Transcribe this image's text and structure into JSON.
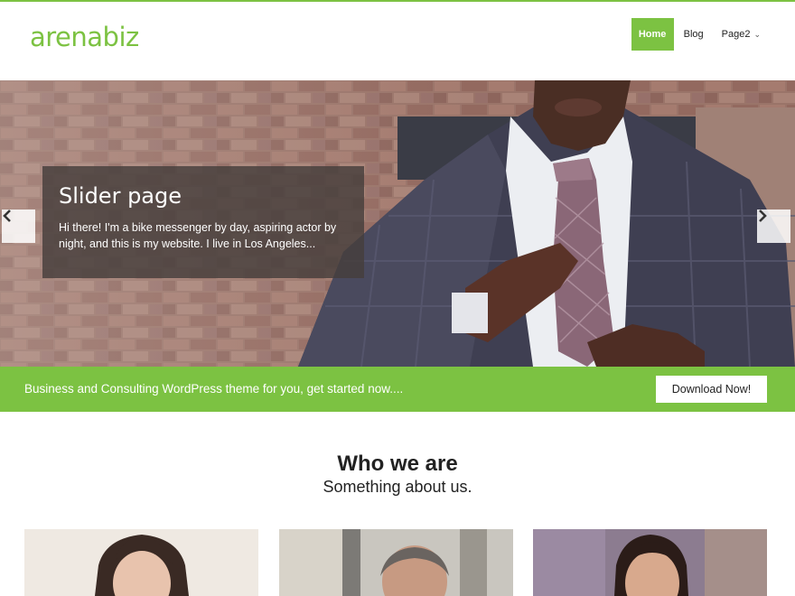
{
  "header": {
    "logo": "arenabiz",
    "nav": [
      {
        "label": "Home",
        "active": true
      },
      {
        "label": "Blog",
        "active": false
      },
      {
        "label": "Page2",
        "active": false,
        "has_dropdown": true
      }
    ]
  },
  "slider": {
    "title": "Slider page",
    "text": "Hi there! I'm a bike messenger by day, aspiring actor by night, and this is my website. I live in Los Angeles...",
    "prev_icon": "chevron-left-icon",
    "next_icon": "chevron-right-icon"
  },
  "cta": {
    "text": "Business and Consulting WordPress theme for you, get started now....",
    "button": "Download Now!"
  },
  "about": {
    "title": "Who we are",
    "subtitle": "Something about us."
  },
  "colors": {
    "accent": "#7cc242",
    "text": "#222222"
  }
}
